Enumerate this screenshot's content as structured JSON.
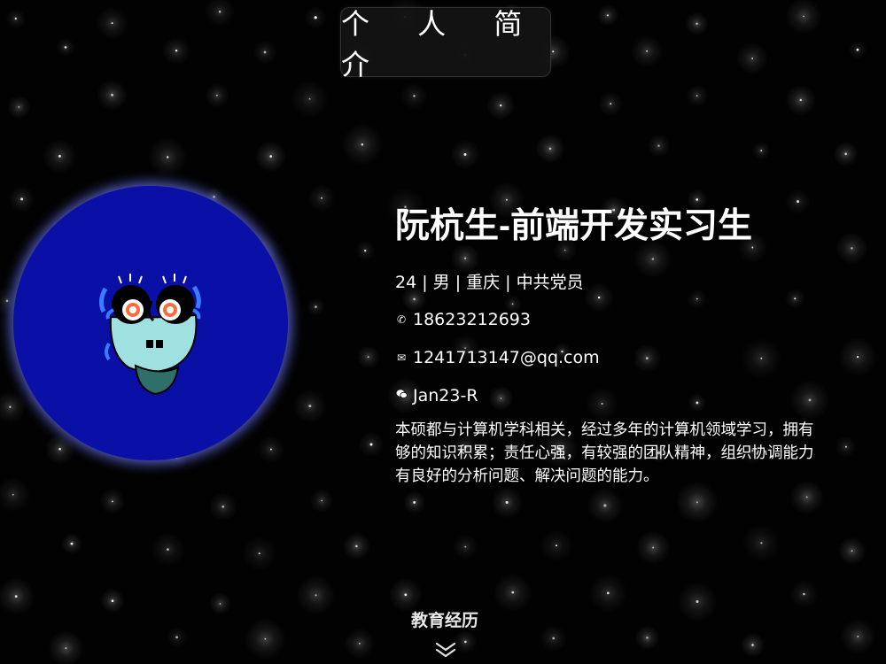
{
  "header": {
    "title": "个 人 简 介"
  },
  "profile": {
    "name": "阮杭生-前端开发实习生",
    "basic": "24 | 男 | 重庆 | 中共党员",
    "phone": "18623212693",
    "email": "1241713147@qq.com",
    "wechat": "Jan23-R",
    "bio_lines": [
      "本硕都与计算机学科相关，经过多年的计算机领域学习，拥有",
      "够的知识积累；责任心强，有较强的团队精神，组织协调能力",
      "有良好的分析问题、解决问题的能力。"
    ]
  },
  "icons": {
    "phone": "phone-icon",
    "email": "mail-icon",
    "wechat": "wechat-icon",
    "scroll": "double-chevron-down-icon"
  },
  "nav": {
    "education_label": "教育经历"
  },
  "colors": {
    "background": "#000000",
    "avatar_bg": "#0a0fa6",
    "avatar_glow": "#6e78ff",
    "face": "#9fe0e0",
    "tongue": "#2f6f6a"
  }
}
